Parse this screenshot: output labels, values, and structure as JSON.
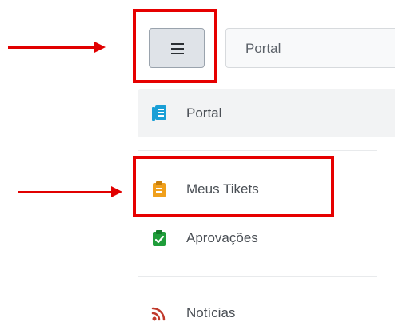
{
  "header": {
    "menu_button": {
      "icon": "hamburger-menu-icon"
    },
    "search": {
      "value": "Portal"
    }
  },
  "sidebar": {
    "items": [
      {
        "label": "Portal",
        "icon": "portal-book-icon",
        "icon_color": "#1a9fd6",
        "active": true
      },
      {
        "label": "Meus Tikets",
        "icon": "clipboard-icon",
        "icon_color": "#f0a01c",
        "active": false
      },
      {
        "label": "Aprovações",
        "icon": "clipboard-check-icon",
        "icon_color": "#1f9d3a",
        "active": false
      },
      {
        "label": "Notícias",
        "icon": "rss-feed-icon",
        "icon_color": "#c0392b",
        "active": false
      }
    ]
  },
  "annotations": {
    "highlight_color": "#e60000"
  }
}
